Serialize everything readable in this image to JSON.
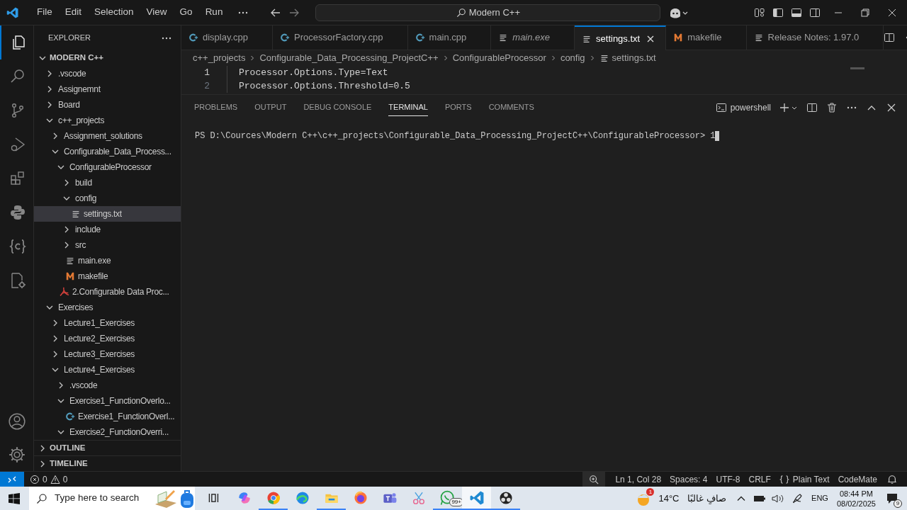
{
  "menu": [
    "File",
    "Edit",
    "Selection",
    "View",
    "Go",
    "Run"
  ],
  "command_center": {
    "value": "Modern C++"
  },
  "activity_bar": [
    {
      "kind": "explorer",
      "selected": true
    },
    {
      "kind": "search",
      "selected": false
    },
    {
      "kind": "source-control",
      "selected": false
    },
    {
      "kind": "run-debug",
      "selected": false
    },
    {
      "kind": "extensions",
      "selected": false
    },
    {
      "kind": "python",
      "selected": false
    },
    {
      "kind": "braces",
      "selected": false
    },
    {
      "kind": "cpp-settings",
      "selected": false
    }
  ],
  "explorer": {
    "title": "EXPLORER",
    "root": "MODERN C++",
    "tree": [
      {
        "label": ".vscode",
        "kind": "folder",
        "expanded": false
      },
      {
        "label": "Assignemnt",
        "kind": "folder",
        "expanded": false
      },
      {
        "label": "Board",
        "kind": "folder",
        "expanded": false
      },
      {
        "label": "c++_projects",
        "kind": "folder",
        "expanded": true,
        "children": [
          {
            "label": "Assignment_solutions",
            "kind": "folder",
            "expanded": false
          },
          {
            "label": "Configurable_Data_Process...",
            "kind": "folder",
            "expanded": true,
            "children": [
              {
                "label": "ConfigurableProcessor",
                "kind": "folder",
                "expanded": true,
                "children": [
                  {
                    "label": "build",
                    "kind": "folder",
                    "expanded": false
                  },
                  {
                    "label": "config",
                    "kind": "folder",
                    "expanded": true,
                    "children": [
                      {
                        "label": "settings.txt",
                        "kind": "txt",
                        "selected": true
                      }
                    ]
                  },
                  {
                    "label": "include",
                    "kind": "folder",
                    "expanded": false
                  },
                  {
                    "label": "src",
                    "kind": "folder",
                    "expanded": false
                  },
                  {
                    "label": "main.exe",
                    "kind": "txt",
                    "selected": false
                  },
                  {
                    "label": "makefile",
                    "kind": "make",
                    "selected": false
                  }
                ]
              },
              {
                "label": "2.Configurable Data Proc...",
                "kind": "pdf",
                "selected": false
              }
            ]
          }
        ]
      },
      {
        "label": "Exercises",
        "kind": "folder",
        "expanded": true,
        "children": [
          {
            "label": "Lecture1_Exercises",
            "kind": "folder",
            "expanded": false
          },
          {
            "label": "Lecture2_Exercises",
            "kind": "folder",
            "expanded": false
          },
          {
            "label": "Lecture3_Exercises",
            "kind": "folder",
            "expanded": false
          },
          {
            "label": "Lecture4_Exercises",
            "kind": "folder",
            "expanded": true,
            "children": [
              {
                "label": ".vscode",
                "kind": "folder",
                "expanded": false
              },
              {
                "label": "Exercise1_FunctionOverlo...",
                "kind": "folder",
                "expanded": true,
                "children": [
                  {
                    "label": "Exercise1_FunctionOverl...",
                    "kind": "cpp",
                    "selected": false
                  }
                ]
              },
              {
                "label": "Exercise2_FunctionOverri...",
                "kind": "folder",
                "expanded": true
              }
            ]
          }
        ]
      }
    ],
    "sections": [
      {
        "label": "OUTLINE",
        "expanded": false
      },
      {
        "label": "TIMELINE",
        "expanded": false
      }
    ]
  },
  "tabs": [
    {
      "label": "display.cpp",
      "kind": "cpp",
      "preview": false,
      "selected": false
    },
    {
      "label": "ProcessorFactory.cpp",
      "kind": "cpp",
      "preview": false,
      "selected": false
    },
    {
      "label": "main.cpp",
      "kind": "cpp",
      "preview": false,
      "selected": false
    },
    {
      "label": "main.exe",
      "kind": "txt",
      "preview": true,
      "selected": false
    },
    {
      "label": "settings.txt",
      "kind": "txt",
      "preview": false,
      "selected": true
    },
    {
      "label": "makefile",
      "kind": "make",
      "preview": false,
      "selected": false
    },
    {
      "label": "Release Notes: 1.97.0",
      "kind": "txt",
      "preview": false,
      "selected": false
    }
  ],
  "breadcrumbs": [
    {
      "label": "c++_projects",
      "kind": "folder"
    },
    {
      "label": "Configurable_Data_Processing_ProjectC++",
      "kind": "folder"
    },
    {
      "label": "ConfigurableProcessor",
      "kind": "folder"
    },
    {
      "label": "config",
      "kind": "folder"
    },
    {
      "label": "settings.txt",
      "kind": "txt"
    }
  ],
  "editor": {
    "lines": [
      {
        "number": "1",
        "text": "Processor.Options.Type=Text",
        "current": true
      },
      {
        "number": "2",
        "text": "Processor.Options.Threshold=0.5",
        "current": false
      }
    ]
  },
  "panel": {
    "tabs": [
      {
        "label": "PROBLEMS",
        "selected": false
      },
      {
        "label": "OUTPUT",
        "selected": false
      },
      {
        "label": "DEBUG CONSOLE",
        "selected": false
      },
      {
        "label": "TERMINAL",
        "selected": true
      },
      {
        "label": "PORTS",
        "selected": false
      },
      {
        "label": "COMMENTS",
        "selected": false
      }
    ],
    "shell": "powershell",
    "terminal": {
      "prompt": "PS D:\\Cources\\Modern C++\\c++_projects\\Configurable_Data_Processing_ProjectC++\\ConfigurableProcessor>",
      "input": "1"
    }
  },
  "status_bar": {
    "errors": "0",
    "warnings": "0",
    "items": [
      {
        "label": "Ln 1, Col 28",
        "kind": "text"
      },
      {
        "label": "Spaces: 4",
        "kind": "text"
      },
      {
        "label": "UTF-8",
        "kind": "text"
      },
      {
        "label": "CRLF",
        "kind": "text"
      },
      {
        "label": "Plain Text",
        "kind": "language"
      },
      {
        "label": "CodeMate",
        "kind": "text"
      }
    ]
  },
  "taskbar": {
    "search": {
      "placeholder": "Type here to search"
    },
    "apps": [
      {
        "kind": "task-view",
        "running": false,
        "selected": false
      },
      {
        "kind": "swirl",
        "running": false,
        "selected": false
      },
      {
        "kind": "chrome",
        "running": true,
        "selected": false
      },
      {
        "kind": "edge",
        "running": false,
        "selected": false
      },
      {
        "kind": "folder",
        "running": true,
        "selected": false
      },
      {
        "kind": "firefox",
        "running": false,
        "selected": false
      },
      {
        "kind": "teams",
        "running": false,
        "selected": false
      },
      {
        "kind": "snip",
        "running": false,
        "selected": false
      },
      {
        "kind": "whatsapp",
        "running": true,
        "selected": false,
        "badge": "99+"
      },
      {
        "kind": "vscode",
        "running": true,
        "selected": true
      },
      {
        "kind": "obs",
        "running": true,
        "selected": false
      }
    ],
    "weather": {
      "badge": "1",
      "temperature": "14°C",
      "condition": "صافٍ غالبًا"
    },
    "language": "ENG",
    "time": "08:44 PM",
    "date": "08/02/2025",
    "notifications": "9"
  }
}
